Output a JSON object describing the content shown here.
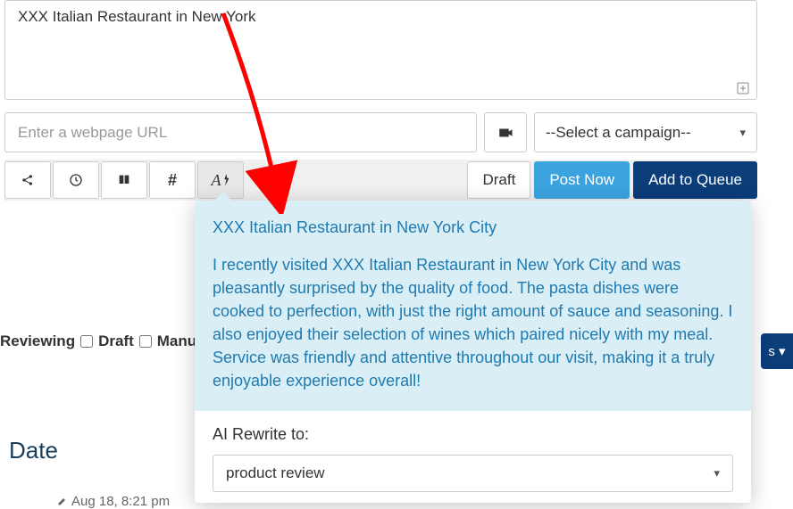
{
  "composer": {
    "text": "XXX Italian Restaurant in New York",
    "url_placeholder": "Enter a webpage URL",
    "campaign_placeholder": "--Select a campaign--"
  },
  "toolbar": {
    "share_icon": "share",
    "clock_icon": "clock",
    "book_icon": "book",
    "hash_label": "#",
    "ai_label": "A",
    "draft": "Draft",
    "post_now": "Post Now",
    "add_queue": "Add to Queue"
  },
  "filters": {
    "reviewing": "Reviewing",
    "draft": "Draft",
    "manu": "Manu"
  },
  "ai_popover": {
    "title": "XXX Italian Restaurant in New York City",
    "body": "I recently visited XXX Italian Restaurant in New York City and was pleasantly surprised by the quality of food. The pasta dishes were cooked to perfection, with just the right amount of sauce and seasoning. I also enjoyed their selection of wines which paired nicely with my meal. Service was friendly and attentive throughout our visit, making it a truly enjoyable experience overall!",
    "rewrite_label": "AI Rewrite to:",
    "rewrite_value": "product review"
  },
  "table": {
    "date_header": "Date",
    "timestamp": "Aug 18, 8:21 pm"
  },
  "right_pill": "s ▾"
}
